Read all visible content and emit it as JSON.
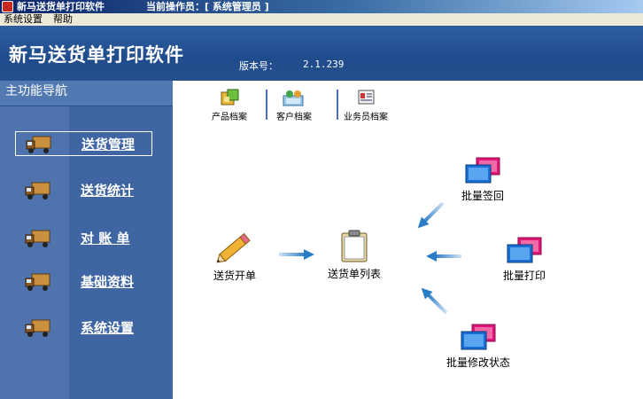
{
  "window": {
    "title": "新马送货单打印软件",
    "operator": "当前操作员：[ 系统管理员 ]"
  },
  "menu": {
    "items": [
      "系统设置",
      "帮助"
    ]
  },
  "header": {
    "app_title": "新马送货单打印软件",
    "version_label": "版本号：",
    "version_value": "2.1.239"
  },
  "sidebar": {
    "title": "主功能导航",
    "items": [
      {
        "label": "送货管理",
        "active": true,
        "icon": "truck-icon"
      },
      {
        "label": "送货统计",
        "active": false,
        "icon": "truck-icon"
      },
      {
        "label": "对 账 单",
        "active": false,
        "icon": "truck-icon"
      },
      {
        "label": "基础资料",
        "active": false,
        "icon": "truck-icon"
      },
      {
        "label": "系统设置",
        "active": false,
        "icon": "truck-icon"
      }
    ]
  },
  "toolbar": {
    "items": [
      {
        "label": "产品档案",
        "icon": "product-archive-icon"
      },
      {
        "label": "客户档案",
        "icon": "customer-archive-icon"
      },
      {
        "label": "业务员档案",
        "icon": "salesman-archive-icon"
      }
    ]
  },
  "flow": {
    "create_order": "送货开单",
    "order_list": "送货单列表",
    "batch_sign": "批量签回",
    "batch_print": "批量打印",
    "batch_status": "批量修改状态"
  },
  "colors": {
    "header_bg": "#1f4c8d",
    "sidebar_bg": "#4f73ad",
    "accent_arrow": "#4a8fd0",
    "monitor_back": "#e0157a",
    "monitor_front": "#1a6fd6"
  }
}
